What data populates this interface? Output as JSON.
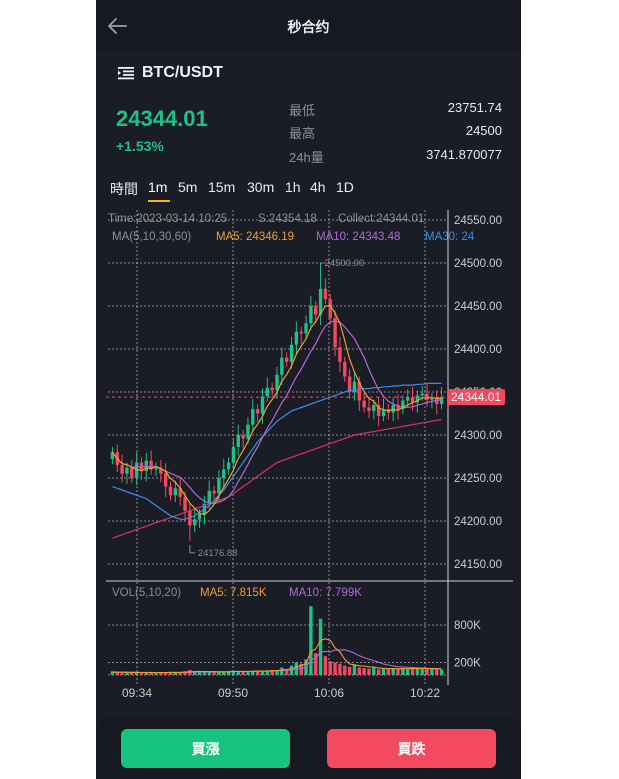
{
  "header": {
    "title": "秒合约"
  },
  "market": {
    "pair": "BTC/USDT",
    "price": "24344.01",
    "change": "+1.53%",
    "stats": [
      {
        "label": "最低",
        "value": "23751.74"
      },
      {
        "label": "最高",
        "value": "24500"
      },
      {
        "label": "24h量",
        "value": "3741.870077"
      }
    ]
  },
  "timeframes": [
    {
      "label": "時間",
      "active": false
    },
    {
      "label": "1m",
      "active": true
    },
    {
      "label": "5m",
      "active": false
    },
    {
      "label": "15m",
      "active": false
    },
    {
      "label": "30m",
      "active": false
    },
    {
      "label": "1h",
      "active": false
    },
    {
      "label": "4h",
      "active": false
    },
    {
      "label": "1D",
      "active": false
    }
  ],
  "chart_data": {
    "type": "candlestick",
    "info_line": {
      "time": "Time:2023-03-14 10:25",
      "s": "S:24354.18",
      "collect": "Collect:24344.01"
    },
    "ma_legend": [
      {
        "label": "MA(5,10,30,60)",
        "color": "#8a8e9e"
      },
      {
        "label": "MA5: 24346.19",
        "color": "#f0a030"
      },
      {
        "label": "MA10: 24343.48",
        "color": "#b06ad4"
      },
      {
        "label": "MA30: 24",
        "color": "#3a8ee6"
      }
    ],
    "y_ticks": [
      "24550.00",
      "24500.00",
      "24450.00",
      "24400.00",
      "24350.00",
      "24300.00",
      "24250.00",
      "24200.00",
      "24150.00"
    ],
    "y_values": [
      24550,
      24500,
      24450,
      24400,
      24350,
      24300,
      24250,
      24200,
      24150
    ],
    "x_ticks": [
      "09:34",
      "09:50",
      "10:06",
      "10:22"
    ],
    "last_price_label": "24344.01",
    "last_price": 24344.01,
    "max_label": "24500.00",
    "min_label": "24176.88",
    "colors": {
      "up": "#1ec286",
      "down": "#f34a60",
      "ma5": "#f0a030",
      "ma10": "#b06ad4",
      "ma30": "#3a8ee6",
      "ma60": "#d6336c"
    },
    "candles_close": [
      24280,
      24265,
      24255,
      24262,
      24250,
      24268,
      24258,
      24270,
      24260,
      24262,
      24255,
      24240,
      24230,
      24238,
      24228,
      24212,
      24195,
      24202,
      24208,
      24220,
      24235,
      24232,
      24250,
      24260,
      24268,
      24286,
      24300,
      24296,
      24312,
      24330,
      24325,
      24345,
      24355,
      24352,
      24370,
      24390,
      24385,
      24405,
      24420,
      24418,
      24430,
      24450,
      24440,
      24470,
      24458,
      24436,
      24402,
      24385,
      24368,
      24350,
      24362,
      24340,
      24332,
      24328,
      24335,
      24322,
      24330,
      24326,
      24335,
      24330,
      24340,
      24344,
      24338,
      24346,
      24348,
      24341,
      24343,
      24336,
      24344.01
    ],
    "candles_open": [
      24272,
      24280,
      24265,
      24255,
      24262,
      24250,
      24268,
      24258,
      24270,
      24260,
      24262,
      24255,
      24240,
      24230,
      24238,
      24228,
      24212,
      24195,
      24202,
      24208,
      24220,
      24235,
      24232,
      24250,
      24260,
      24268,
      24286,
      24300,
      24296,
      24312,
      24330,
      24325,
      24345,
      24355,
      24352,
      24370,
      24390,
      24385,
      24405,
      24420,
      24418,
      24430,
      24450,
      24440,
      24470,
      24458,
      24436,
      24402,
      24385,
      24368,
      24350,
      24362,
      24340,
      24332,
      24328,
      24335,
      24322,
      24330,
      24326,
      24335,
      24330,
      24340,
      24344,
      24338,
      24346,
      24348,
      24341,
      24343,
      24336
    ],
    "ma30": [
      24240,
      24238,
      24236,
      24234,
      24232,
      24230,
      24228,
      24226,
      24222,
      24218,
      24214,
      24210,
      24206,
      24204,
      24202,
      24202,
      24204,
      24206,
      24210,
      24214,
      24218,
      24224,
      24230,
      24236,
      24244,
      24252,
      24260,
      24268,
      24276,
      24284,
      24292,
      24298,
      24304,
      24310,
      24316,
      24320,
      24324,
      24328,
      24330,
      24332,
      24334,
      24336,
      24338,
      24340,
      24342,
      24344,
      24346,
      24348,
      24350,
      24352,
      24352,
      24353,
      24354,
      24354,
      24355,
      24355,
      24356,
      24356,
      24357,
      24357,
      24358,
      24358,
      24358,
      24359,
      24359,
      24360,
      24360,
      24360,
      24360
    ],
    "ma60": [
      24180,
      24182,
      24184,
      24186,
      24188,
      24190,
      24192,
      24194,
      24196,
      24198,
      24200,
      24202,
      24204,
      24206,
      24208,
      24210,
      24212,
      24214,
      24216,
      24218,
      24220,
      24222,
      24224,
      24226,
      24228,
      24232,
      24236,
      24240,
      24244,
      24248,
      24252,
      24256,
      24260,
      24264,
      24268,
      24270,
      24272,
      24274,
      24276,
      24278,
      24280,
      24282,
      24284,
      24286,
      24288,
      24290,
      24292,
      24294,
      24296,
      24298,
      24300,
      24301,
      24302,
      24303,
      24304,
      24305,
      24306,
      24307,
      24308,
      24309,
      24310,
      24311,
      24312,
      24313,
      24314,
      24315,
      24316,
      24317,
      24318
    ],
    "volume": {
      "legend": [
        {
          "label": "VOL(5,10,20)",
          "color": "#8a8e9e"
        },
        {
          "label": "MA5: 7.815K",
          "color": "#f0a030"
        },
        {
          "label": "MA10: 7.799K",
          "color": "#b06ad4"
        }
      ],
      "y_ticks": [
        "800K",
        "200K"
      ],
      "y_values": [
        800,
        200
      ],
      "ymax": 1200,
      "values": [
        60,
        40,
        30,
        50,
        35,
        45,
        30,
        40,
        35,
        30,
        40,
        45,
        50,
        40,
        35,
        60,
        80,
        55,
        45,
        40,
        50,
        45,
        60,
        50,
        55,
        70,
        60,
        50,
        55,
        65,
        70,
        60,
        75,
        80,
        65,
        120,
        90,
        150,
        200,
        180,
        250,
        1100,
        350,
        900,
        300,
        220,
        200,
        180,
        150,
        130,
        160,
        120,
        110,
        100,
        120,
        90,
        100,
        95,
        110,
        100,
        105,
        95,
        100,
        110,
        105,
        100,
        95,
        90,
        85
      ],
      "ma5": [
        45,
        45,
        44,
        43,
        42,
        41,
        40,
        40,
        39,
        38,
        38,
        39,
        41,
        42,
        42,
        45,
        50,
        55,
        58,
        56,
        54,
        53,
        50,
        50,
        52,
        56,
        58,
        58,
        58,
        60,
        62,
        62,
        64,
        68,
        70,
        80,
        86,
        100,
        125,
        150,
        180,
        376,
        416,
        556,
        580,
        554,
        434,
        370,
        250,
        176,
        164,
        148,
        144,
        130,
        128,
        110,
        108,
        101,
        103,
        99,
        102,
        100,
        102,
        102,
        104,
        102,
        101,
        100,
        97
      ],
      "ma10": [
        48,
        47,
        46,
        45,
        44,
        43,
        42,
        41,
        40,
        40,
        40,
        40,
        40,
        41,
        41,
        43,
        45,
        47,
        49,
        49,
        50,
        51,
        53,
        53,
        53,
        55,
        55,
        54,
        55,
        57,
        60,
        60,
        61,
        63,
        64,
        71,
        76,
        82,
        93,
        103,
        130,
        235,
        274,
        361,
        380,
        368,
        400,
        400,
        404,
        380,
        350,
        308,
        280,
        252,
        230,
        204,
        176,
        160,
        145,
        132,
        130,
        124,
        120,
        116,
        114,
        108,
        105,
        102,
        100
      ]
    }
  },
  "actions": {
    "buy_up": "買漲",
    "buy_down": "買跌"
  }
}
